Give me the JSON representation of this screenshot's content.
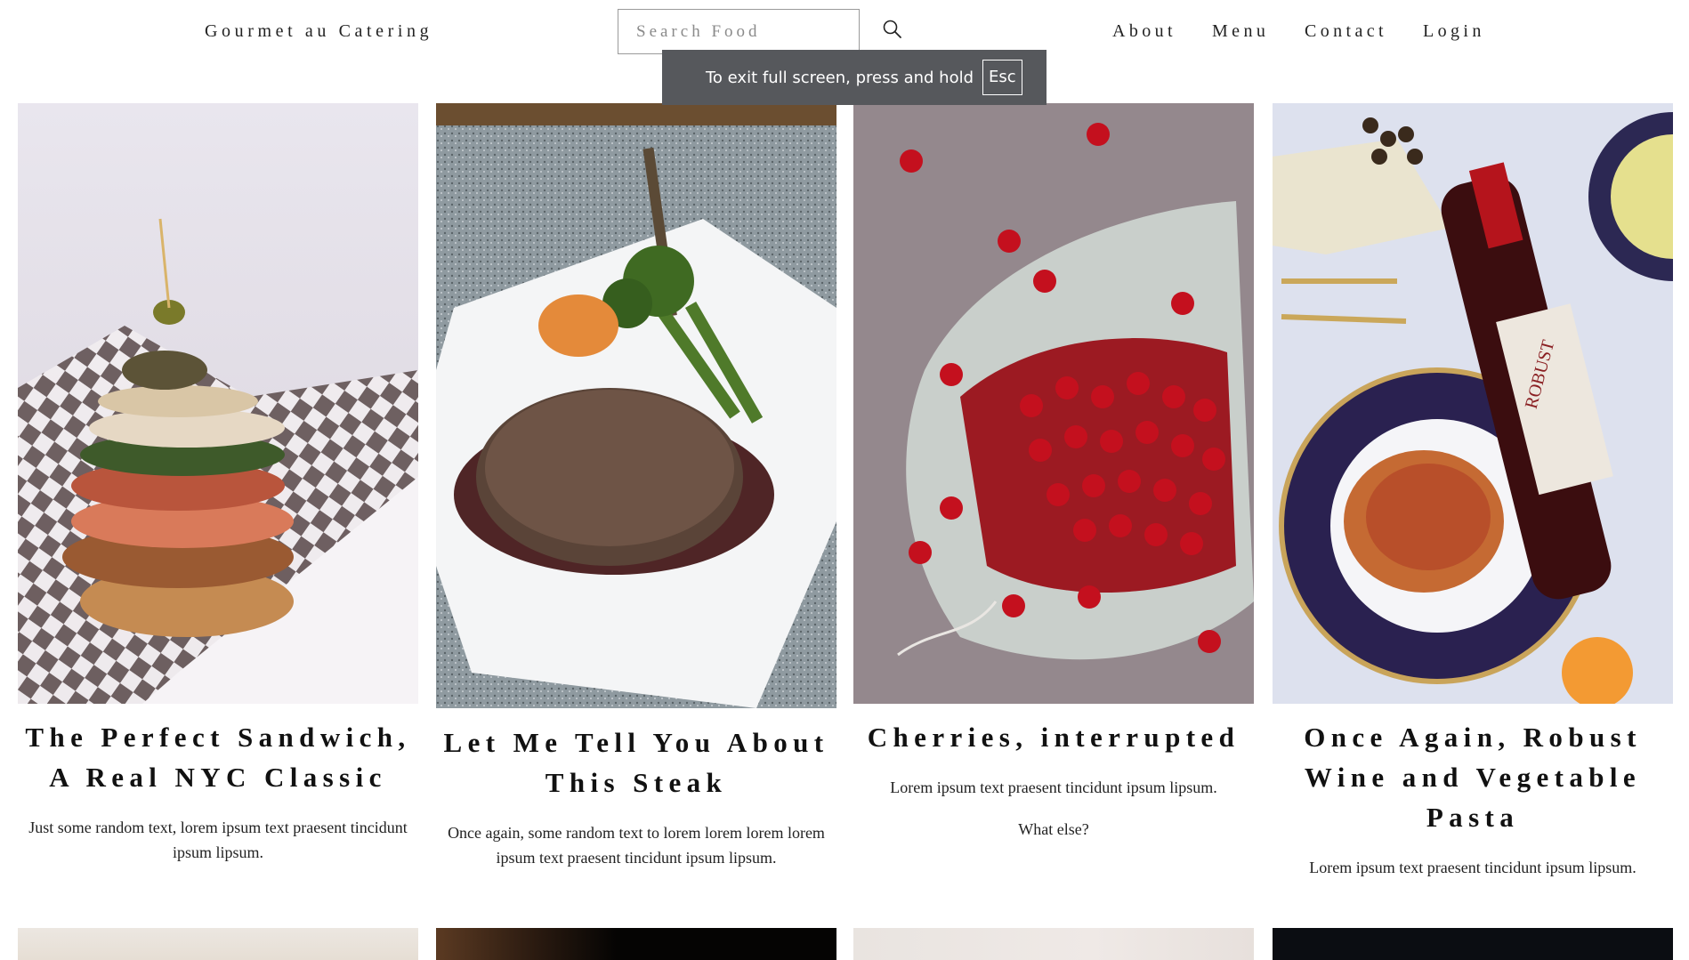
{
  "header": {
    "brand": "Gourmet au Catering",
    "search_placeholder": "Search Food",
    "search_icon": "magnifier-icon",
    "nav": [
      "About",
      "Menu",
      "Contact",
      "Login"
    ]
  },
  "fullscreen_notice": {
    "message": "To exit full screen, press and hold",
    "key": "Esc"
  },
  "cards": [
    {
      "image": "stacked-sandwich-photo",
      "title": "The Perfect Sandwich, A Real NYC Classic",
      "text": [
        "Just some random text, lorem ipsum text praesent tincidunt ipsum lipsum."
      ]
    },
    {
      "image": "steak-plate-photo",
      "title": "Let Me Tell You About This Steak",
      "text": [
        "Once again, some random text to lorem lorem lorem lorem ipsum text praesent tincidunt ipsum lipsum."
      ]
    },
    {
      "image": "cherries-in-cloth-photo",
      "title": "Cherries, interrupted",
      "text": [
        "Lorem ipsum text praesent tincidunt ipsum lipsum.",
        "What else?"
      ]
    },
    {
      "image": "wine-and-pasta-photo",
      "title": "Once Again, Robust Wine and Vegetable Pasta",
      "text": [
        "Lorem ipsum text praesent tincidunt ipsum lipsum."
      ],
      "bottle_label": "ROBUST"
    }
  ],
  "colors": {
    "toast_bg": "#56585c",
    "text": "#222222",
    "search_border": "#9a9a9a"
  }
}
